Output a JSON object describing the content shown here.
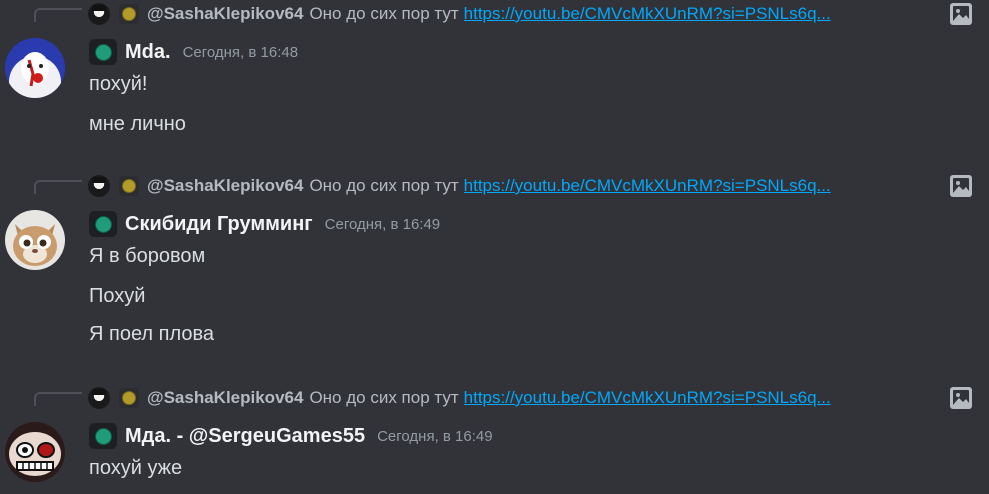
{
  "messages": [
    {
      "reply": {
        "author": "@SashaKlepikov64",
        "text": "Оно до сих пор тут",
        "link": "https://youtu.be/CMVcMkXUnRM?si=PSNLs6q..."
      },
      "username": "Mda.",
      "timestamp": "Сегодня, в 16:48",
      "lines": [
        "похуй!",
        "мне лично"
      ]
    },
    {
      "reply": {
        "author": "@SashaKlepikov64",
        "text": "Оно до сих пор тут",
        "link": "https://youtu.be/CMVcMkXUnRM?si=PSNLs6q..."
      },
      "username": "Скибиди Грумминг",
      "timestamp": "Сегодня, в 16:49",
      "lines": [
        "Я в боровом",
        "Похуй",
        "Я поел плова"
      ]
    },
    {
      "reply": {
        "author": "@SashaKlepikov64",
        "text": "Оно до сих пор тут",
        "link": "https://youtu.be/CMVcMkXUnRM?si=PSNLs6q..."
      },
      "username": "Мда. - @SergeuGames55",
      "timestamp": "Сегодня, в 16:49",
      "lines": [
        "похуй уже"
      ]
    }
  ],
  "colors": {
    "background": "#313338",
    "link": "#00a8fc",
    "role_dot": "#1f9d7a",
    "reply_badge_dot": "#b59a2a"
  }
}
